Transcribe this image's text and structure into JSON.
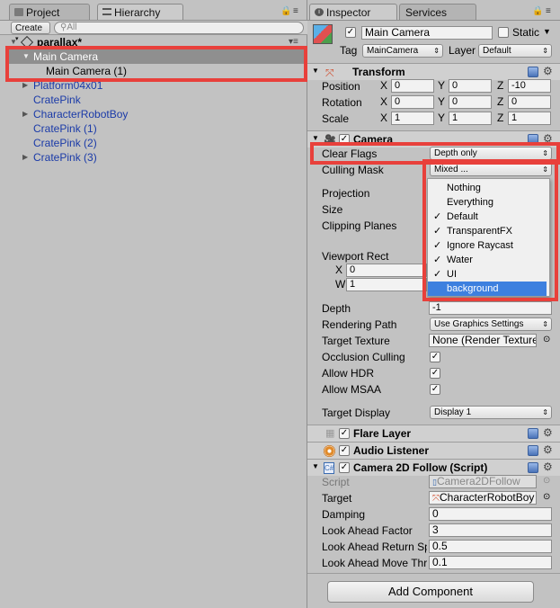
{
  "left_tabs": {
    "project": "Project",
    "hierarchy": "Hierarchy"
  },
  "right_tabs": {
    "inspector": "Inspector",
    "services": "Services"
  },
  "hierarchy": {
    "create_label": "Create",
    "search_placeholder": "All",
    "scene": "parallax*",
    "items": [
      {
        "label": "Main Camera",
        "selected": true
      },
      {
        "label": "Main Camera (1)"
      },
      {
        "label": "Platform04x01"
      },
      {
        "label": "CratePink"
      },
      {
        "label": "CharacterRobotBoy"
      },
      {
        "label": "CratePink (1)"
      },
      {
        "label": "CratePink (2)"
      },
      {
        "label": "CratePink (3)"
      }
    ]
  },
  "inspector": {
    "object_name": "Main Camera",
    "static_label": "Static",
    "tag_label": "Tag",
    "tag_value": "MainCamera",
    "layer_label": "Layer",
    "layer_value": "Default",
    "transform": {
      "title": "Transform",
      "position": {
        "label": "Position",
        "x": "0",
        "y": "0",
        "z": "-10"
      },
      "rotation": {
        "label": "Rotation",
        "x": "0",
        "y": "0",
        "z": "0"
      },
      "scale": {
        "label": "Scale",
        "x": "1",
        "y": "1",
        "z": "1"
      },
      "axis_x": "X",
      "axis_y": "Y",
      "axis_z": "Z"
    },
    "camera": {
      "title": "Camera",
      "clear_flags_label": "Clear Flags",
      "clear_flags_value": "Depth only",
      "culling_mask_label": "Culling Mask",
      "culling_mask_value": "Mixed ...",
      "projection_label": "Projection",
      "size_label": "Size",
      "clipping_label": "Clipping Planes",
      "viewport_label": "Viewport Rect",
      "vp_x_label": "X",
      "vp_x_value": "0",
      "vp_w_label": "W",
      "vp_w_value": "1",
      "depth_label": "Depth",
      "depth_value": "-1",
      "rendering_path_label": "Rendering Path",
      "rendering_path_value": "Use Graphics Settings",
      "target_texture_label": "Target Texture",
      "target_texture_value": "None (Render Texture",
      "occlusion_label": "Occlusion Culling",
      "hdr_label": "Allow HDR",
      "msaa_label": "Allow MSAA",
      "target_display_label": "Target Display",
      "target_display_value": "Display 1"
    },
    "culling_menu": [
      {
        "label": "Nothing",
        "checked": false
      },
      {
        "label": "Everything",
        "checked": false
      },
      {
        "label": "Default",
        "checked": true
      },
      {
        "label": "TransparentFX",
        "checked": true
      },
      {
        "label": "Ignore Raycast",
        "checked": true
      },
      {
        "label": "Water",
        "checked": true
      },
      {
        "label": "UI",
        "checked": true
      },
      {
        "label": "background",
        "checked": false,
        "highlighted": true
      }
    ],
    "flare_layer": "Flare Layer",
    "audio_listener": "Audio Listener",
    "follow": {
      "title": "Camera 2D Follow (Script)",
      "script_label": "Script",
      "script_value": "Camera2DFollow",
      "target_label": "Target",
      "target_value": "CharacterRobotBoy",
      "damping_label": "Damping",
      "damping_value": "0",
      "laf_label": "Look Ahead Factor",
      "laf_value": "3",
      "lars_label": "Look Ahead Return Sp",
      "lars_value": "0.5",
      "lamt_label": "Look Ahead Move Thr",
      "lamt_value": "0.1"
    },
    "add_component": "Add Component"
  },
  "colors": {
    "highlight_red": "#e8403b",
    "selection_blue": "#3d80df",
    "hierarchy_blue": "#1a3aa8"
  }
}
